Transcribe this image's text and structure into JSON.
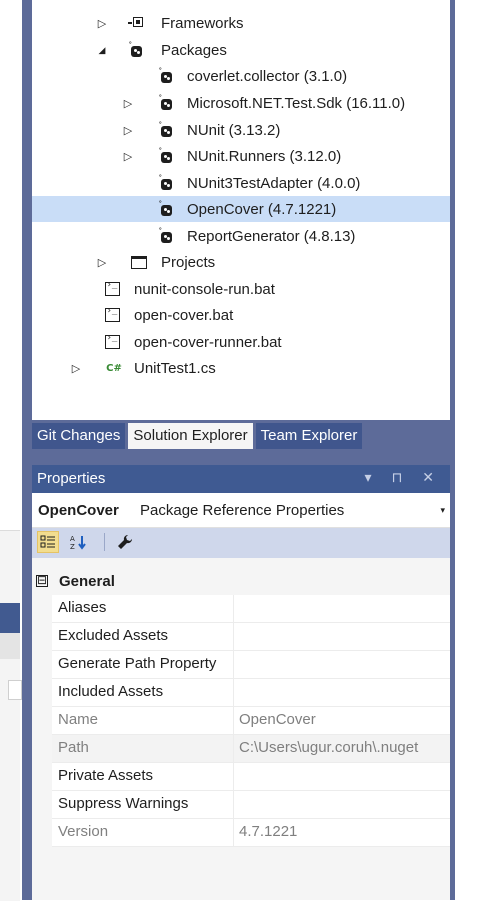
{
  "tree": {
    "items": [
      {
        "label": "Frameworks",
        "expander": "▷",
        "icon": "frameworks-icon"
      },
      {
        "label": "Packages",
        "expander": "◢",
        "icon": "package-icon"
      },
      {
        "label": "coverlet.collector (3.1.0)",
        "expander": "",
        "icon": "package-icon"
      },
      {
        "label": "Microsoft.NET.Test.Sdk (16.11.0)",
        "expander": "▷",
        "icon": "package-icon"
      },
      {
        "label": "NUnit (3.13.2)",
        "expander": "▷",
        "icon": "package-icon"
      },
      {
        "label": "NUnit.Runners (3.12.0)",
        "expander": "▷",
        "icon": "package-icon"
      },
      {
        "label": "NUnit3TestAdapter (4.0.0)",
        "expander": "",
        "icon": "package-icon"
      },
      {
        "label": "OpenCover (4.7.1221)",
        "expander": "",
        "icon": "package-icon",
        "selected": true
      },
      {
        "label": "ReportGenerator (4.8.13)",
        "expander": "",
        "icon": "package-icon"
      },
      {
        "label": "Projects",
        "expander": "▷",
        "icon": "project-icon"
      },
      {
        "label": "nunit-console-run.bat",
        "expander": "",
        "icon": "batch-file-icon"
      },
      {
        "label": "open-cover.bat",
        "expander": "",
        "icon": "batch-file-icon"
      },
      {
        "label": "open-cover-runner.bat",
        "expander": "",
        "icon": "batch-file-icon"
      },
      {
        "label": "UnitTest1.cs",
        "expander": "▷",
        "icon": "csharp-file-icon",
        "icon_text": "C#"
      }
    ]
  },
  "tabs": [
    {
      "label": "Git Changes",
      "active": false
    },
    {
      "label": "Solution Explorer",
      "active": true
    },
    {
      "label": "Team Explorer",
      "active": false
    }
  ],
  "properties": {
    "title": "Properties",
    "title_buttons": "▾ ⊓ ✕",
    "object_name": "OpenCover",
    "object_type": "Package Reference Properties",
    "dropdown_glyph": "▾",
    "category": "General",
    "category_toggle": "⊟",
    "rows": [
      {
        "key": "Aliases",
        "value": "",
        "readonly": false
      },
      {
        "key": "Excluded Assets",
        "value": "",
        "readonly": false
      },
      {
        "key": "Generate Path Property",
        "value": "",
        "readonly": false
      },
      {
        "key": "Included Assets",
        "value": "",
        "readonly": false
      },
      {
        "key": "Name",
        "value": "OpenCover",
        "readonly": true
      },
      {
        "key": "Path",
        "value": "C:\\Users\\ugur.coruh\\.nuget",
        "readonly": true
      },
      {
        "key": "Private Assets",
        "value": "",
        "readonly": false
      },
      {
        "key": "Suppress Warnings",
        "value": "",
        "readonly": false
      },
      {
        "key": "Version",
        "value": "4.7.1221",
        "readonly": true
      }
    ]
  },
  "colors": {
    "frame": "#5d6b99",
    "selection": "#c9ddf7",
    "title_bar": "#3f5a92",
    "toolbar": "#cfd7eb"
  }
}
